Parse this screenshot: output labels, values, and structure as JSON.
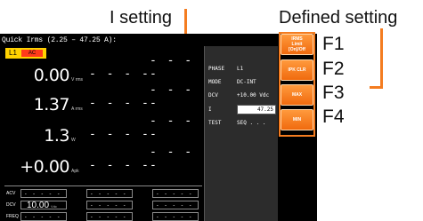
{
  "callouts": {
    "i_setting": "I setting",
    "defined_setting": "Defined setting"
  },
  "fkeys": [
    "F1",
    "F2",
    "F3",
    "F4"
  ],
  "screen": {
    "title": "Quick Irms (2.25 – 47.25 A):",
    "range": {
      "label": "L1",
      "badge": "AC"
    },
    "measurements": [
      {
        "value": "0.00",
        "unit": "V rms",
        "dashes": "- - - -"
      },
      {
        "value": "1.37",
        "unit": "A rms",
        "dashes": "- - - -"
      },
      {
        "value": "1.3",
        "unit": "W",
        "dashes": "- - - -"
      },
      {
        "value": "+0.00",
        "unit": "Apk",
        "dashes": "- - - -"
      }
    ],
    "lower": [
      {
        "label": "ACV",
        "cells": [
          "- - - - -",
          "- - - - -",
          "- - - - -"
        ]
      },
      {
        "label": "DCV",
        "cells": [
          "10.00",
          "- - - - -",
          "- - - - -"
        ],
        "unit": "Vdc"
      },
      {
        "label": "FREQ",
        "cells": [
          "- - - - -",
          "- - - - -",
          "- - - - -"
        ]
      }
    ],
    "panel": {
      "phase": {
        "label": "PHASE",
        "value": "L1"
      },
      "mode": {
        "label": "MODE",
        "value": "DC-INT"
      },
      "dcv": {
        "label": "DCV",
        "value": "+10.00 Vdc"
      },
      "i": {
        "label": "I",
        "value": "47.25"
      },
      "test": {
        "label": "TEST",
        "value": "SEQ . . ."
      }
    },
    "softkeys": [
      {
        "lines": [
          "IRMS",
          "Limit",
          "[On]/Off"
        ]
      },
      {
        "lines": [
          "IPK CLR"
        ]
      },
      {
        "lines": [
          "MAX"
        ]
      },
      {
        "lines": [
          "MIN"
        ]
      }
    ]
  },
  "colors": {
    "accent": "#f47c20",
    "range_box": "#ffd200",
    "range_badge": "#ff3a1a",
    "screen_bg": "#000000",
    "panel_bg": "#2c2c2c"
  }
}
